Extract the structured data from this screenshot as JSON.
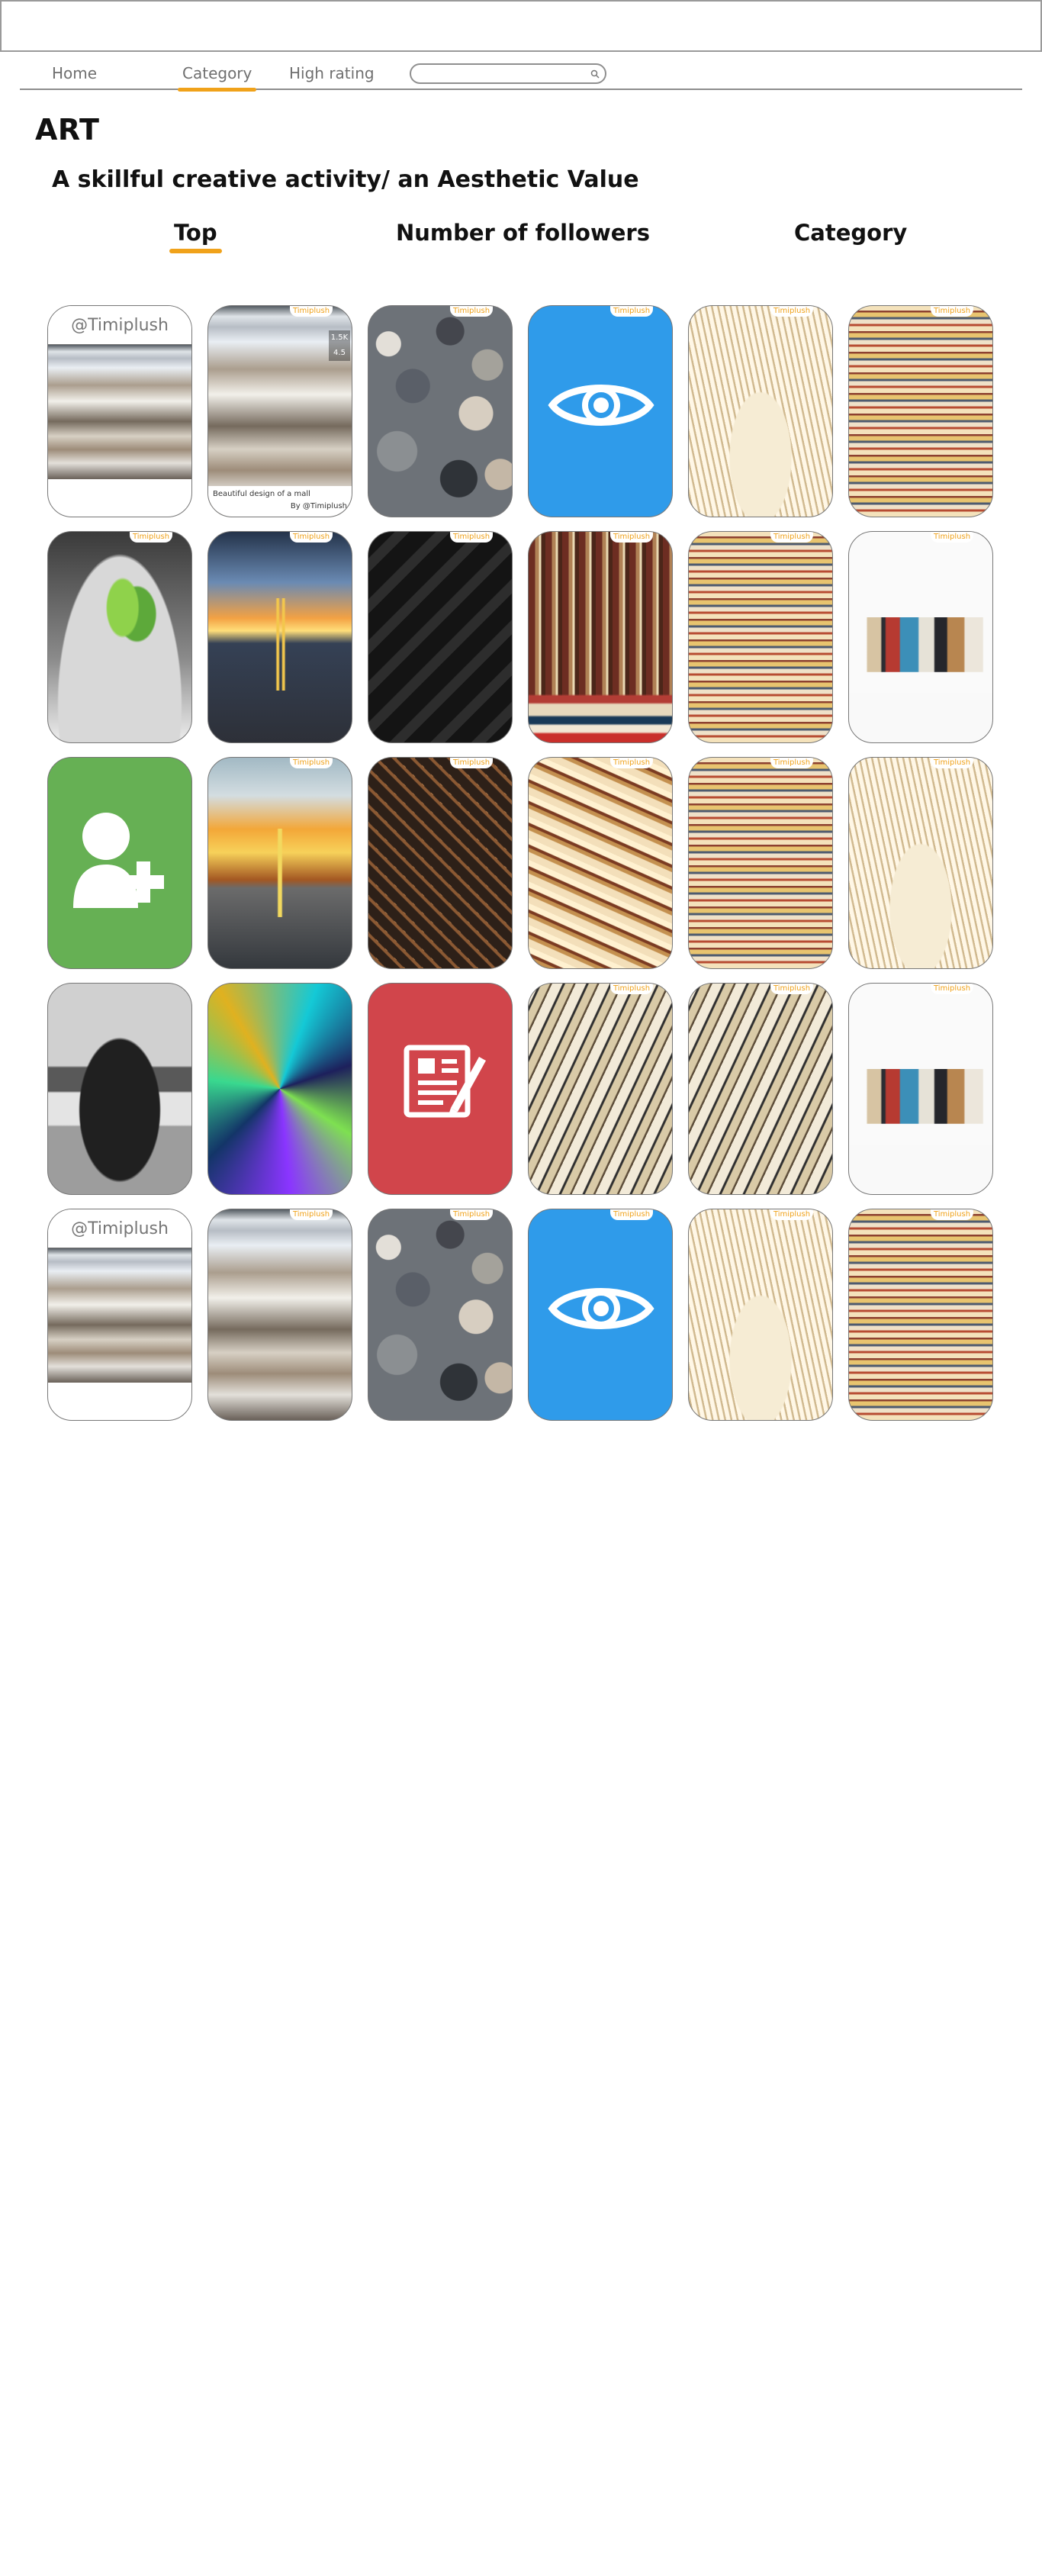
{
  "nav": {
    "items": [
      {
        "label": "Home"
      },
      {
        "label": "Category"
      },
      {
        "label": "High rating"
      }
    ],
    "active": "Category",
    "search_placeholder": ""
  },
  "page": {
    "title": "ART",
    "subtitle": "A skillful creative activity/ an Aesthetic Value"
  },
  "tabs": [
    {
      "label": "Top"
    },
    {
      "label": "Number of followers"
    },
    {
      "label": "Category"
    }
  ],
  "active_tab": "Top",
  "featured": {
    "username": "@Timiplush",
    "caption": "Beautiful design of a mall",
    "byline": "By @Timiplush",
    "followers": "1.5K",
    "rating": "4.5"
  },
  "badge": "Timiplush",
  "cards": [
    "profile",
    "mall",
    "stones",
    "eye",
    "book",
    "stack",
    "plant",
    "road",
    "dark",
    "shelf",
    "stack",
    "white-books",
    "add-user",
    "forest",
    "pattern",
    "old-books",
    "stack",
    "book",
    "car",
    "poly",
    "document",
    "spines",
    "spines",
    "white-books",
    "profile",
    "mall",
    "stones",
    "eye",
    "book",
    "stack"
  ],
  "colors": {
    "accent": "#f0a21a",
    "border": "#777777"
  }
}
